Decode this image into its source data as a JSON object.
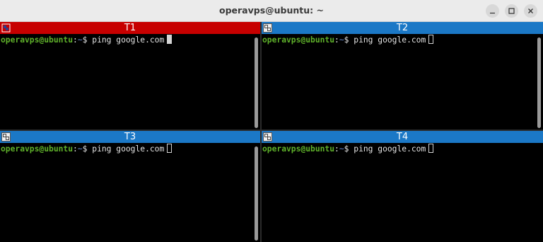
{
  "window": {
    "title": "operavps@ubuntu: ~"
  },
  "panes": [
    {
      "header": "T1",
      "active": true,
      "user_host": "operavps@ubuntu",
      "sep": ":",
      "path": "~",
      "dollar": "$",
      "command": " ping google.com"
    },
    {
      "header": "T2",
      "active": false,
      "user_host": "operavps@ubuntu",
      "sep": ":",
      "path": "~",
      "dollar": "$",
      "command": " ping google.com"
    },
    {
      "header": "T3",
      "active": false,
      "user_host": "operavps@ubuntu",
      "sep": ":",
      "path": "~",
      "dollar": "$",
      "command": " ping google.com"
    },
    {
      "header": "T4",
      "active": false,
      "user_host": "operavps@ubuntu",
      "sep": ":",
      "path": "~",
      "dollar": "$",
      "command": " ping google.com"
    }
  ],
  "colors": {
    "active_header": "#c70000",
    "inactive_header": "#1b78c6",
    "prompt_user": "#5fb12a",
    "terminal_bg": "#000000"
  },
  "icons": {
    "window_minimize": "minimize-icon",
    "window_maximize": "maximize-icon",
    "window_close": "close-icon",
    "pane_menu": "terminal-grid-icon"
  }
}
